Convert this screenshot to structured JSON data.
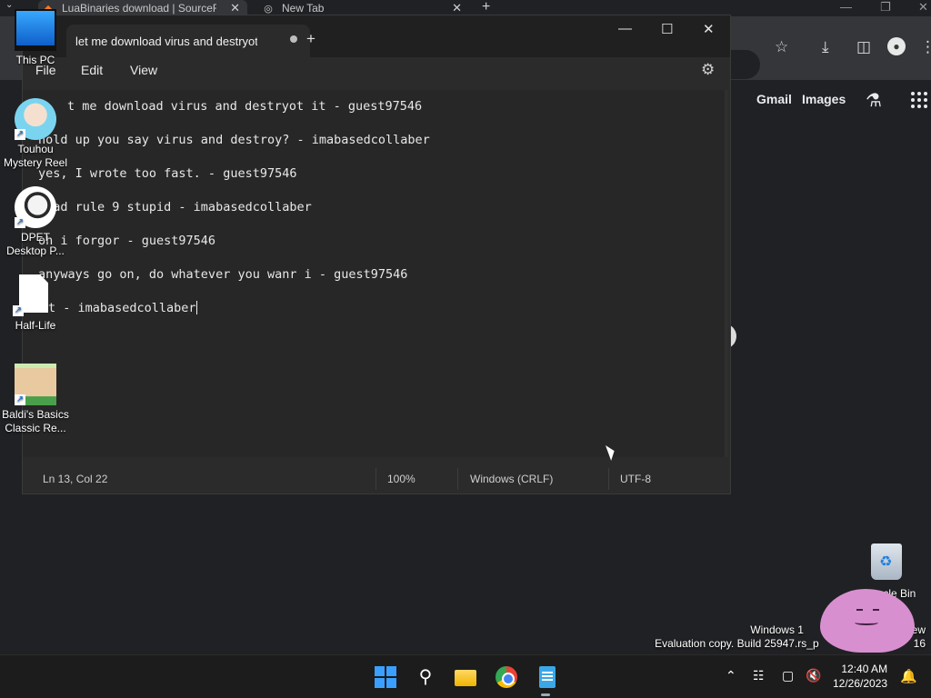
{
  "browser": {
    "tabs": [
      {
        "label": "LuaBinaries download | SourceF"
      },
      {
        "label": "New Tab"
      }
    ],
    "links": {
      "gmail": "Gmail",
      "images": "Images"
    }
  },
  "notepad": {
    "tab_title": "let me download virus and destryot",
    "menu": {
      "file": "File",
      "edit": "Edit",
      "view": "View"
    },
    "lines": [
      "t me download virus and destryot it - guest97546",
      "hold up you say virus and destroy? - imabasedcollaber",
      "yes, I wrote too fast. - guest97546",
      "read rule 9 stupid - imabasedcollaber",
      "oh i forgor - guest97546",
      "anyways go on, do whatever you wanr i - guest97546",
      "t - imabasedcollaber"
    ],
    "status": {
      "position": "Ln 13, Col 22",
      "zoom": "100%",
      "line_ending": "Windows (CRLF)",
      "encoding": "UTF-8"
    }
  },
  "desktop": {
    "icons": [
      {
        "label": "This PC"
      },
      {
        "label": "Touhou Mystery Reel"
      },
      {
        "label": "DPET Desktop P..."
      },
      {
        "label": "Half-Life"
      },
      {
        "label": "Baldi's Basics Classic Re..."
      }
    ],
    "recycle_bin": "Recycle Bin",
    "watermark_line1": "Windows 1",
    "watermark_line1_end": "view",
    "watermark_line2": "Evaluation copy. Build 25947.rs_p",
    "watermark_line2_end": "16"
  },
  "taskbar": {
    "time": "12:40 AM",
    "date": "12/26/2023"
  },
  "colors": {
    "accent": "#3aa0ff",
    "notepad_bg": "#272727",
    "taskbar_bg": "#1c1c1c"
  }
}
